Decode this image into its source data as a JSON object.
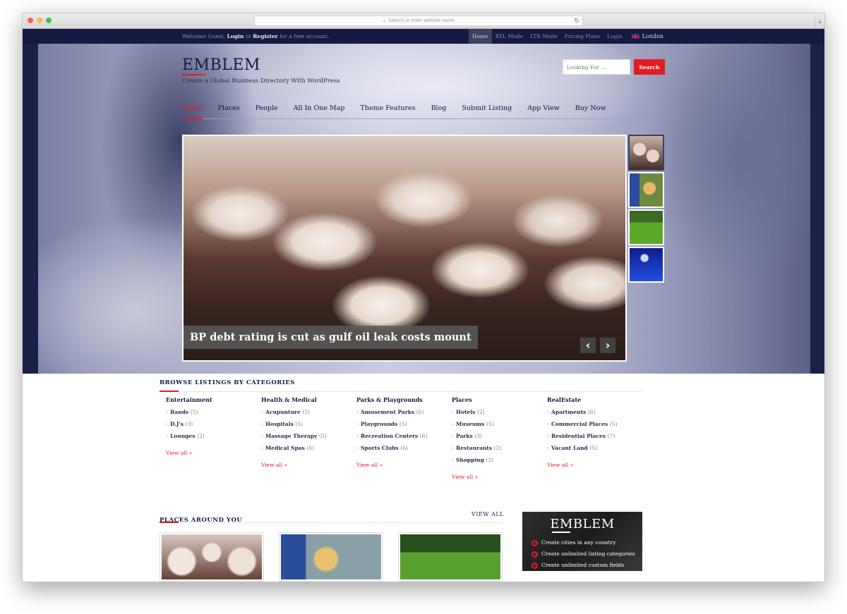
{
  "browser": {
    "url_placeholder": "Search or enter website name",
    "search_icon": "magnifier-icon",
    "reload_icon": "↻",
    "new_tab_icon": "+"
  },
  "topbar": {
    "welcome_prefix": "Welcome Guest, ",
    "login_label": "Login",
    "or_text": " or ",
    "register_label": "Register",
    "welcome_suffix": " for a free account.",
    "links": [
      {
        "label": "Home",
        "active": true
      },
      {
        "label": "RTL Mode",
        "active": false
      },
      {
        "label": "LTR Mode",
        "active": false
      },
      {
        "label": "Pricing Plans",
        "active": false
      },
      {
        "label": "Login",
        "active": false
      }
    ],
    "location": "London"
  },
  "header": {
    "logo": "EMBLEM",
    "tagline": "Create a Global Business Directory With WordPress",
    "search_placeholder": "Looking For ...",
    "search_button": "Search",
    "accent_color": "#e31b23",
    "brand_color": "#141a42"
  },
  "nav": {
    "items": [
      {
        "label": "Home",
        "active": true
      },
      {
        "label": "Places",
        "active": false
      },
      {
        "label": "People",
        "active": false
      },
      {
        "label": "All In One Map",
        "active": false
      },
      {
        "label": "Theme Features",
        "active": false
      },
      {
        "label": "Blog",
        "active": false
      },
      {
        "label": "Submit Listing",
        "active": false
      },
      {
        "label": "App View",
        "active": false
      },
      {
        "label": "Buy Now",
        "active": false
      }
    ]
  },
  "slider": {
    "caption": "BP debt rating is cut as gulf oil leak costs mount",
    "prev_icon": "‹",
    "next_icon": "›",
    "thumbnails": [
      "cupcakes",
      "child-at-playground",
      "laptop-on-grass",
      "blue-lightning"
    ]
  },
  "categories": {
    "title": "BROWSE LISTINGS BY CATEGORIES",
    "view_all": "View all »",
    "groups": [
      {
        "name": "Entertainment",
        "items": [
          {
            "label": "Bands",
            "count": "(5)"
          },
          {
            "label": "D.J's",
            "count": "(3)"
          },
          {
            "label": "Lounges",
            "count": "(2)"
          }
        ]
      },
      {
        "name": "Health & Medical",
        "items": [
          {
            "label": "Acupunture",
            "count": "(5)"
          },
          {
            "label": "Hospitals",
            "count": "(5)"
          },
          {
            "label": "Massage Therapy",
            "count": "(5)"
          },
          {
            "label": "Medical Spas",
            "count": "(6)"
          }
        ]
      },
      {
        "name": "Parks & Playgrounds",
        "items": [
          {
            "label": "Amusement Parks",
            "count": "(6)"
          },
          {
            "label": "Playgrounds",
            "count": "(5)"
          },
          {
            "label": "Recreation Centers",
            "count": "(6)"
          },
          {
            "label": "Sports Clubs",
            "count": "(6)"
          }
        ]
      },
      {
        "name": "Places",
        "items": [
          {
            "label": "Hotels",
            "count": "(2)"
          },
          {
            "label": "Museums",
            "count": "(5)"
          },
          {
            "label": "Parks",
            "count": "(3)"
          },
          {
            "label": "Restaurants",
            "count": "(2)"
          },
          {
            "label": "Shopping",
            "count": "(2)"
          }
        ]
      },
      {
        "name": "RealEstate",
        "items": [
          {
            "label": "Apartments",
            "count": "(6)"
          },
          {
            "label": "Commercial Places",
            "count": "(5)"
          },
          {
            "label": "Residential Places",
            "count": "(7)"
          },
          {
            "label": "Vacant Land",
            "count": "(5)"
          }
        ]
      }
    ]
  },
  "places": {
    "title": "PLACES AROUND YOU",
    "view_all": "VIEW ALL"
  },
  "promo": {
    "logo": "EMBLEM",
    "features": [
      "Create cities in any country",
      "Create unlimited listing categories",
      "Create unlimited custom fields"
    ]
  }
}
